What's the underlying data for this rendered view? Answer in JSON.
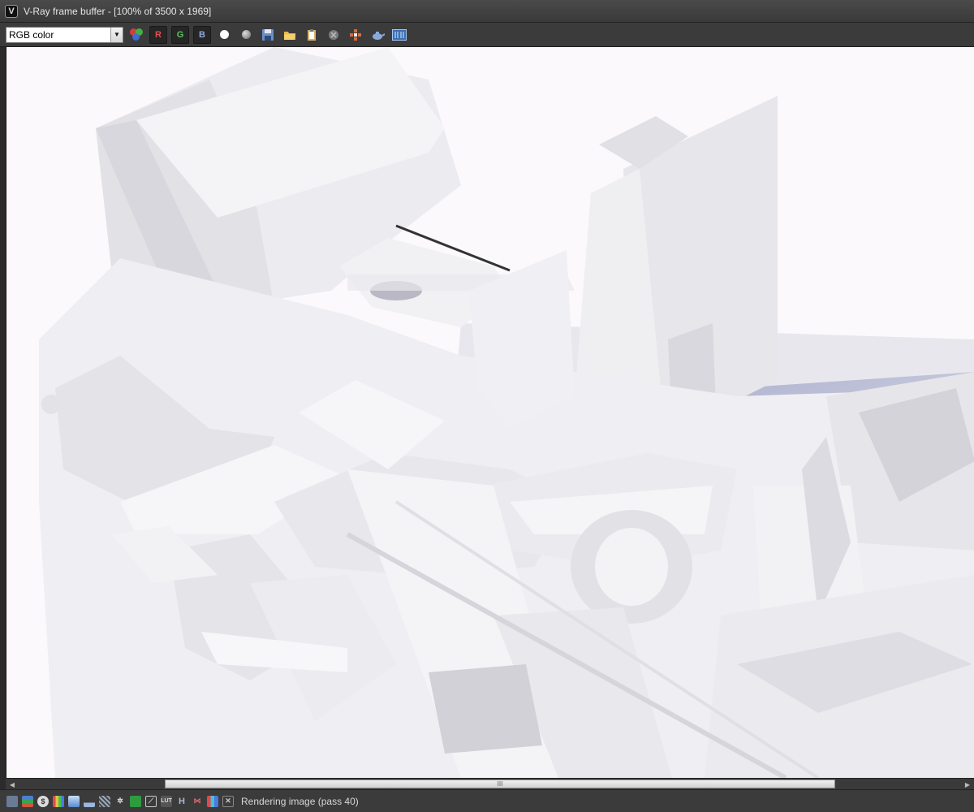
{
  "window": {
    "title": "V-Ray frame buffer - [100% of 3500 x 1969]",
    "app_icon_glyph": "V"
  },
  "toolbar": {
    "channel_value": "RGB color",
    "buttons": [
      {
        "name": "rgb-channels-icon"
      },
      {
        "name": "red-channel-button",
        "label": "R",
        "color": "#e05050"
      },
      {
        "name": "green-channel-button",
        "label": "G",
        "color": "#60c060"
      },
      {
        "name": "blue-channel-button",
        "label": "B",
        "color": "#8da8e0"
      },
      {
        "name": "alpha-white-icon"
      },
      {
        "name": "monochrome-icon"
      },
      {
        "name": "save-icon"
      },
      {
        "name": "open-folder-icon"
      },
      {
        "name": "clipboard-icon"
      },
      {
        "name": "clear-icon"
      },
      {
        "name": "track-mouse-icon"
      },
      {
        "name": "render-teapot-icon"
      },
      {
        "name": "compare-icon"
      }
    ]
  },
  "status": {
    "text": "Rendering image (pass 40)",
    "icons": [
      "frame-icon",
      "layers-icon",
      "dollar-icon",
      "color-bars-icon",
      "lut-icon",
      "histogram-icon",
      "pixel-info-icon",
      "settings-icon",
      "stamp-icon",
      "curve-icon",
      "lut-label-icon",
      "h-icon",
      "stereo-icon",
      "bars-icon",
      "close-small-icon"
    ],
    "h_label": "H",
    "lut_label": "LUT"
  },
  "scrollbar": {
    "thumb_grip": "III"
  }
}
